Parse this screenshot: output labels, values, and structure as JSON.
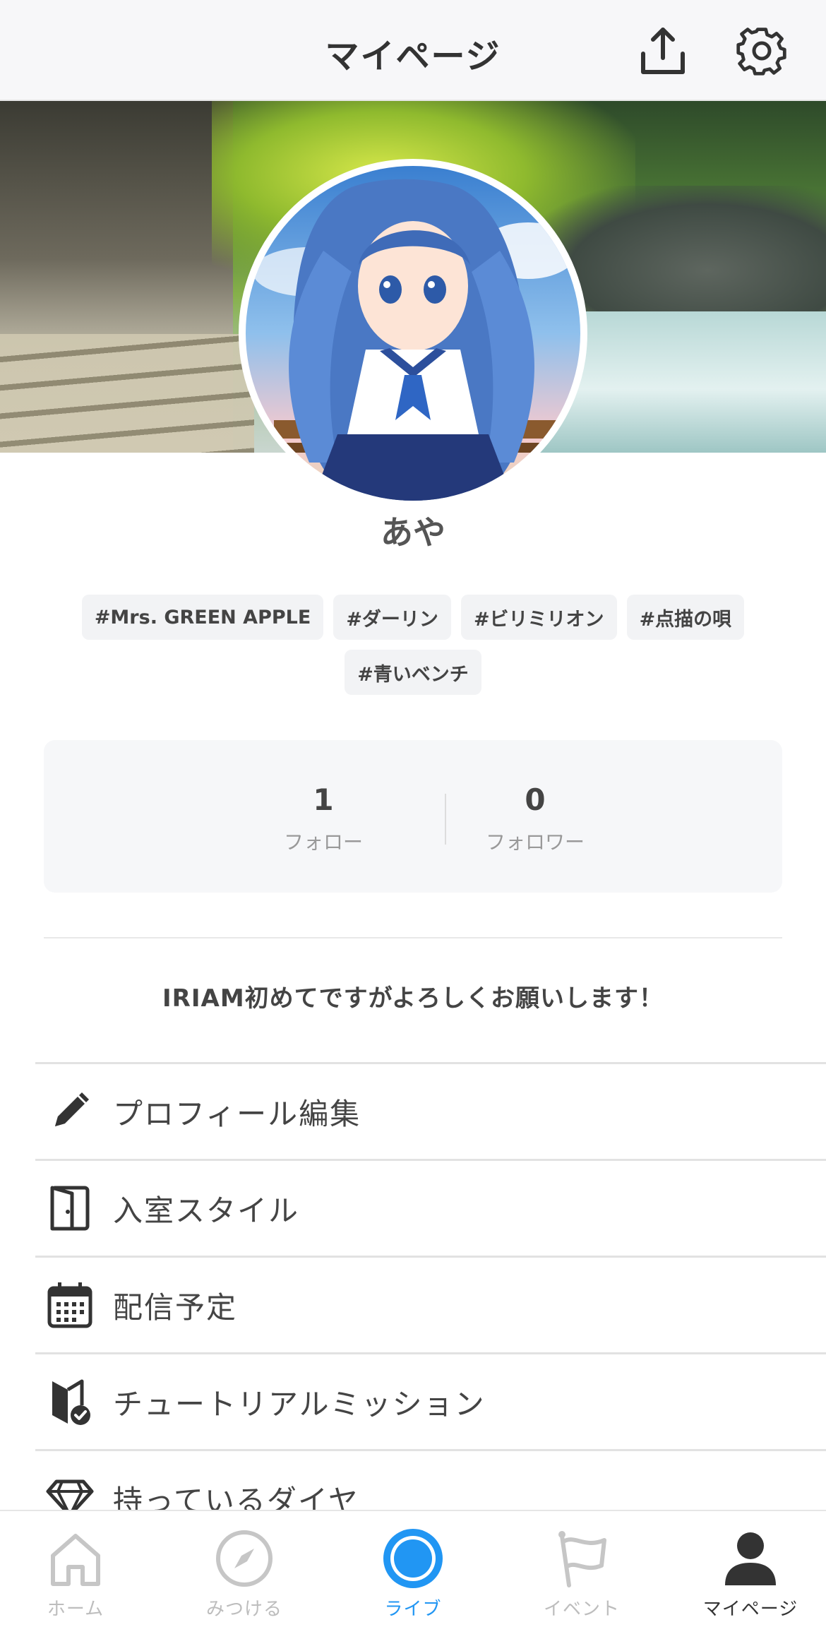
{
  "header": {
    "title": "マイページ"
  },
  "profile": {
    "name": "あや",
    "tags": [
      "#Mrs. GREEN APPLE",
      "#ダーリン",
      "#ビリミリオン",
      "#点描の唄",
      "#青いベンチ"
    ],
    "stats": {
      "follow_count": "1",
      "follow_label": "フォロー",
      "follower_count": "0",
      "follower_label": "フォロワー"
    },
    "bio": "IRIAM初めてですがよろしくお願いします！"
  },
  "menu": {
    "items": [
      {
        "label": "プロフィール編集",
        "icon": "pencil-icon"
      },
      {
        "label": "入室スタイル",
        "icon": "door-icon"
      },
      {
        "label": "配信予定",
        "icon": "calendar-icon"
      },
      {
        "label": "チュートリアルミッション",
        "icon": "beginner-badge-icon"
      },
      {
        "label": "持っているダイヤ",
        "icon": "diamond-icon"
      }
    ]
  },
  "tabbar": {
    "tabs": [
      {
        "label": "ホーム",
        "icon": "home-icon"
      },
      {
        "label": "みつける",
        "icon": "compass-icon"
      },
      {
        "label": "ライブ",
        "icon": "live-icon"
      },
      {
        "label": "イベント",
        "icon": "flag-icon"
      },
      {
        "label": "マイページ",
        "icon": "person-icon"
      }
    ],
    "active_tab": "マイページ",
    "live_color": "#2196f3"
  },
  "colors": {
    "accent": "#2196f3",
    "text": "#3a3a3a",
    "muted": "#999999"
  }
}
